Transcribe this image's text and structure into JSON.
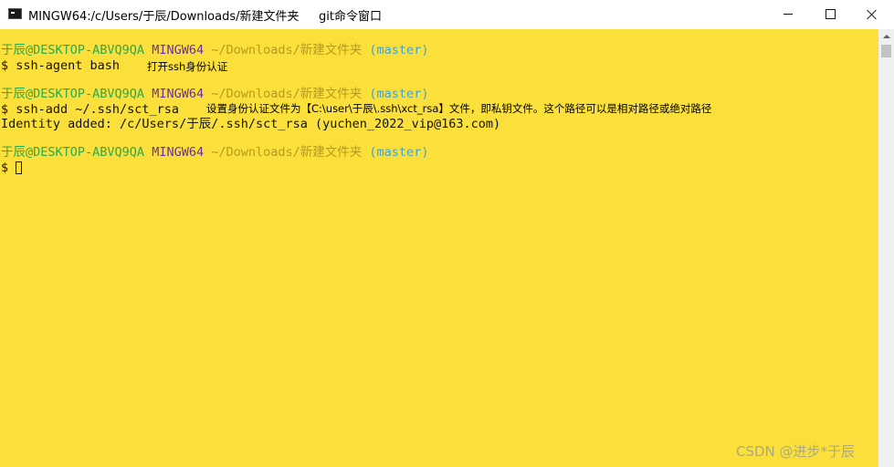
{
  "window": {
    "title": "MINGW64:/c/Users/于辰/Downloads/新建文件夹",
    "title_note": "git命令窗口",
    "controls": [
      "minimize",
      "maximize",
      "close"
    ]
  },
  "terminal": {
    "background": "#fbe03b",
    "prompts": [
      {
        "user_host": "于辰@DESKTOP-ABVQ9QA",
        "system": "MINGW64",
        "path": "~/Downloads/新建文件夹",
        "branch": "(master)"
      },
      {
        "user_host": "于辰@DESKTOP-ABVQ9QA",
        "system": "MINGW64",
        "path": "~/Downloads/新建文件夹",
        "branch": "(master)"
      },
      {
        "user_host": "于辰@DESKTOP-ABVQ9QA",
        "system": "MINGW64",
        "path": "~/Downloads/新建文件夹",
        "branch": "(master)"
      }
    ],
    "commands": [
      "$ ssh-agent bash",
      "$ ssh-add ~/.ssh/sct_rsa",
      "$ "
    ],
    "output": "Identity added: /c/Users/于辰/.ssh/sct_rsa (yuchen_2022_vip@163.com)",
    "annotations": [
      "打开ssh身份认证",
      "设置身份认证文件为【C:\\user\\于辰\\.ssh\\xct_rsa】文件，即私钥文件。这个路径可以是相对路径或绝对路径"
    ]
  },
  "watermark": "CSDN @进步*于辰",
  "colors": {
    "user_host": "#2fa84a",
    "system": "#6a2fa2",
    "path": "#b59b1a",
    "branch": "#3fa3d3"
  }
}
